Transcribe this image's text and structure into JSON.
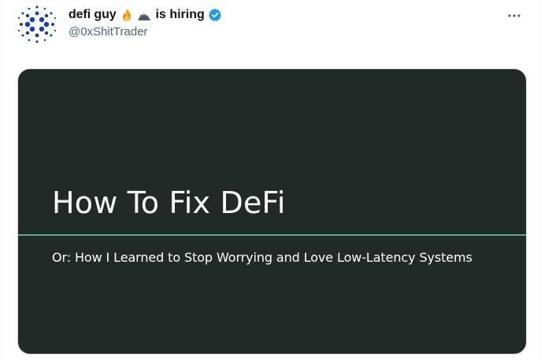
{
  "tweet": {
    "author": {
      "display_name": "defi guy",
      "name_suffix": "is hiring",
      "emojis": [
        "fire-emoji",
        "mountain-emoji"
      ],
      "handle": "@0xShitTrader",
      "verified": true,
      "avatar_icon": "cardano-logo-icon",
      "avatar_color": "#1a3fa8"
    },
    "more_icon": "more-horizontal-icon",
    "media": {
      "background": "#222a29",
      "accent_line_color": "#58a889",
      "title": "How To Fix DeFi",
      "subtitle": "Or: How I Learned to Stop Worrying and Love Low-Latency Systems"
    }
  },
  "colors": {
    "text_primary": "#0f1419",
    "text_secondary": "#536471",
    "verified_blue": "#1d9bf0"
  }
}
